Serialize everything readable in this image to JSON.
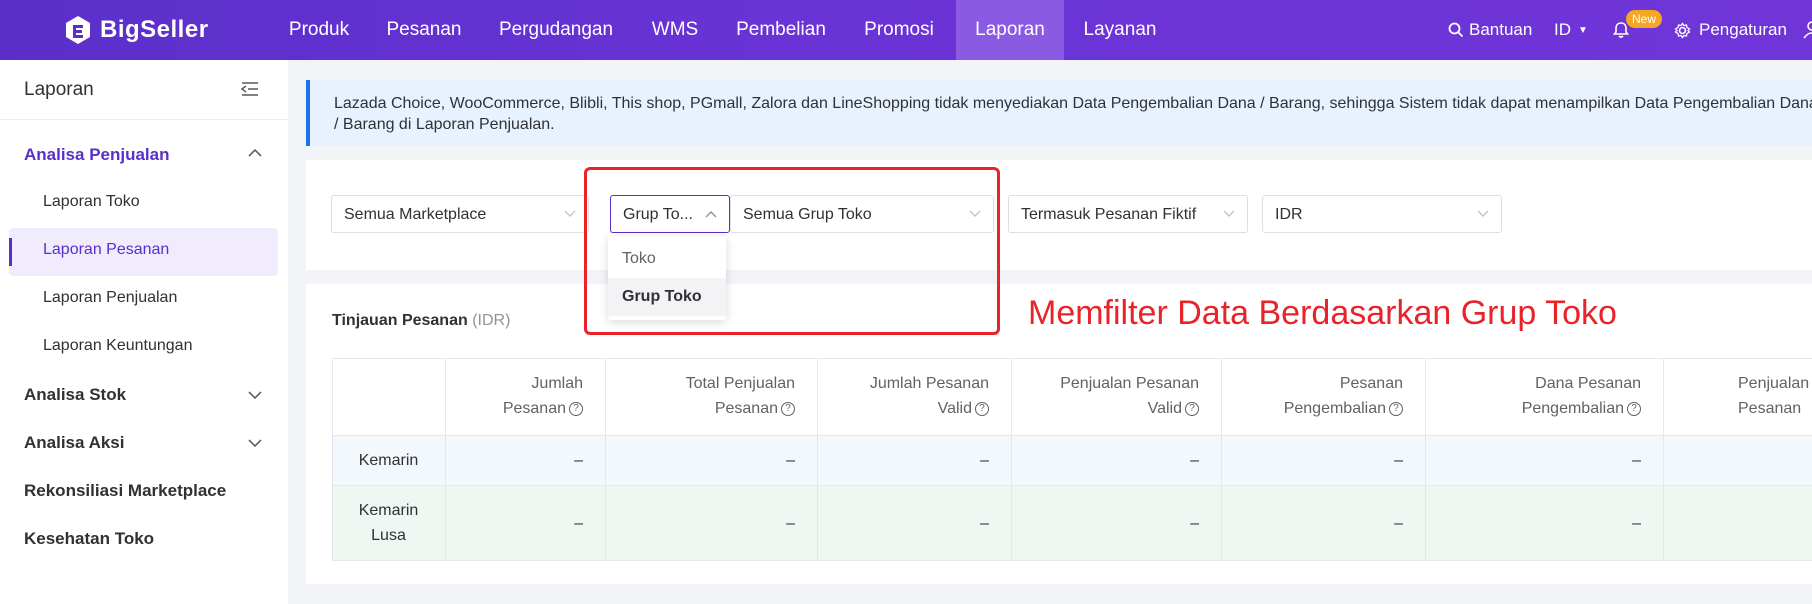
{
  "navbar": {
    "logo": "BigSeller",
    "items": [
      "Produk",
      "Pesanan",
      "Pergudangan",
      "WMS",
      "Pembelian",
      "Promosi",
      "Laporan",
      "Layanan"
    ],
    "active": "Laporan",
    "help": "Bantuan",
    "lang": "ID",
    "new_badge": "New",
    "settings": "Pengaturan"
  },
  "sidebar": {
    "title": "Laporan",
    "sections": [
      {
        "label": "Analisa Penjualan",
        "expanded": true,
        "items": [
          "Laporan Toko",
          "Laporan Pesanan",
          "Laporan Penjualan",
          "Laporan Keuntungan"
        ]
      },
      {
        "label": "Analisa Stok",
        "expanded": false
      },
      {
        "label": "Analisa Aksi",
        "expanded": false
      },
      {
        "label": "Rekonsiliasi Marketplace"
      },
      {
        "label": "Kesehatan Toko"
      }
    ],
    "active_item": "Laporan Pesanan"
  },
  "notice": {
    "line1": "Lazada Choice, WooCommerce, Blibli, This shop, PGmall, Zalora dan LineShopping tidak menyediakan Data Pengembalian Dana / Barang, sehingga Sistem tidak dapat menampilkan Data Pengembalian Dana",
    "line2": "/ Barang di Laporan Penjualan."
  },
  "filters": {
    "marketplace": "Semua Marketplace",
    "group_type": "Grup To...",
    "group_value": "Semua Grup Toko",
    "fiktif": "Termasuk Pesanan Fiktif",
    "currency": "IDR",
    "dropdown_options": [
      "Toko",
      "Grup Toko"
    ],
    "dropdown_selected": "Grup Toko"
  },
  "annotation": "Memfilter Data Berdasarkan Grup Toko",
  "overview": {
    "title": "Tinjauan Pesanan",
    "unit": "(IDR)",
    "columns": [
      {
        "l1": "Jumlah",
        "l2": "Pesanan"
      },
      {
        "l1": "Total Penjualan",
        "l2": "Pesanan"
      },
      {
        "l1": "Jumlah Pesanan",
        "l2": "Valid"
      },
      {
        "l1": "Penjualan Pesanan",
        "l2": "Valid"
      },
      {
        "l1": "Pesanan",
        "l2": "Pengembalian"
      },
      {
        "l1": "Dana Pesanan",
        "l2": "Pengembalian"
      },
      {
        "l1": "Penjualan",
        "l2": "Pesanan"
      }
    ],
    "rows": [
      {
        "label1": "Kemarin",
        "label2": "",
        "values": [
          "–",
          "–",
          "–",
          "–",
          "–",
          "–",
          ""
        ]
      },
      {
        "label1": "Kemarin",
        "label2": "Lusa",
        "values": [
          "–",
          "–",
          "–",
          "–",
          "–",
          "–",
          ""
        ]
      }
    ]
  },
  "colors": {
    "brand": "#5a2fc9",
    "annotation": "#e8242a",
    "notice_bar": "#1a73e8"
  }
}
